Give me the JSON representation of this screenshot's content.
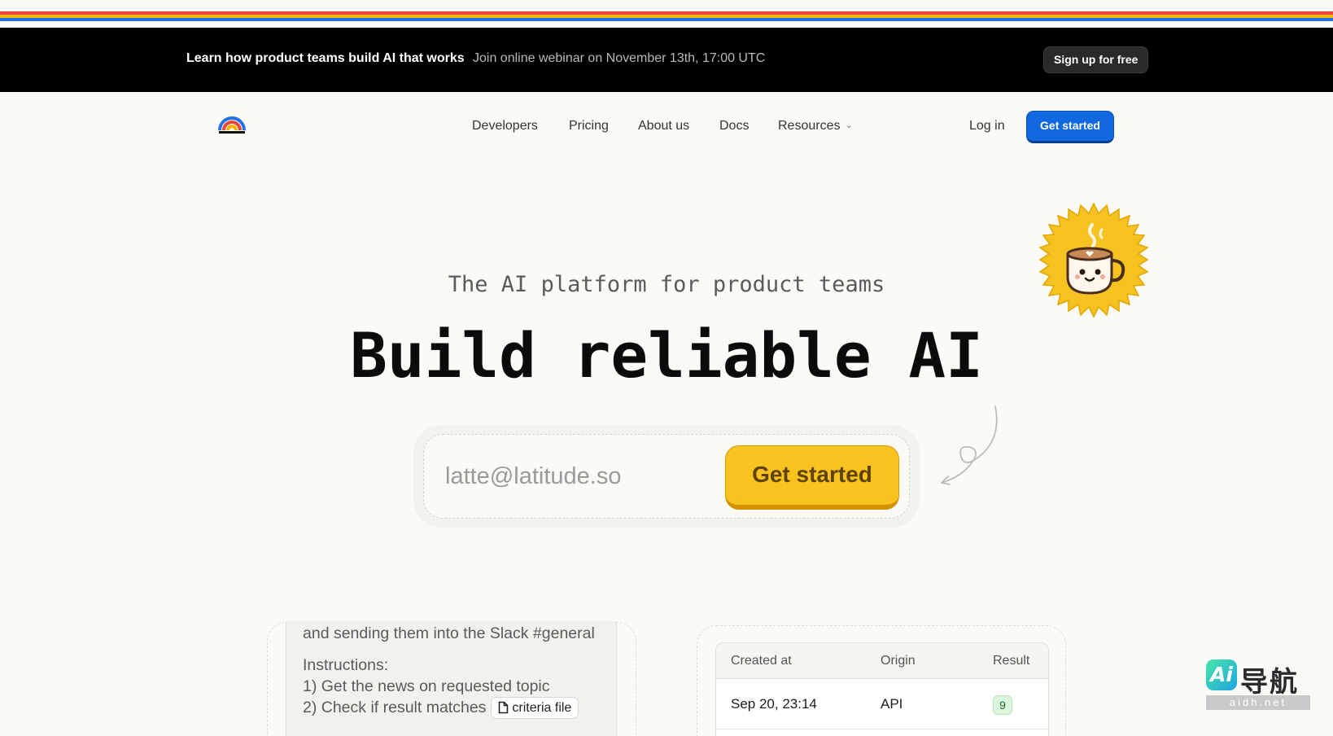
{
  "announcement": {
    "headline": "Learn how product teams build AI that works",
    "detail": "Join online webinar on November 13th, 17:00 UTC",
    "cta": "Sign up for free"
  },
  "nav": {
    "links": [
      "Developers",
      "Pricing",
      "About us",
      "Docs",
      "Resources"
    ],
    "login": "Log in",
    "cta": "Get started"
  },
  "hero": {
    "subtitle": "The AI platform for product teams",
    "headline": "Build reliable AI",
    "email_placeholder": "latte@latitude.so",
    "cta": "Get started"
  },
  "prompt_card": {
    "lines": [
      "and sending them into the Slack #general",
      "Instructions:",
      "1) Get the news on requested topic",
      "2) Check if result matches"
    ],
    "attachment": "criteria file"
  },
  "logs_table": {
    "columns": [
      "Created at",
      "Origin",
      "Result"
    ],
    "rows": [
      {
        "created_at": "Sep 20, 23:14",
        "origin": "API",
        "result": "9"
      }
    ]
  },
  "watermark": {
    "logo_text": "Ai",
    "name": "导航",
    "domain": "aidh.net"
  },
  "colors": {
    "rainbow": [
      "#e8453c",
      "#f4b400",
      "#1e73e8"
    ],
    "primary_blue": "#1168e0",
    "cta_yellow": "#f9c21e",
    "result_badge": "#dcf6de"
  }
}
